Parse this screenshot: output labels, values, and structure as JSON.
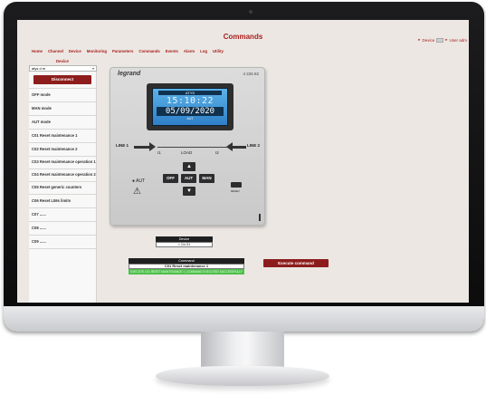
{
  "app": {
    "title": "Commands",
    "device_selector": "Device",
    "user_selector": "User adm"
  },
  "menu": {
    "items": [
      "Home",
      "Channel",
      "Device",
      "Monitoring",
      "Parameters",
      "Commands",
      "Events",
      "Alarm",
      "Log",
      "Utility"
    ],
    "sub_item": "Device"
  },
  "sidebar": {
    "select_value": "atys d m",
    "disconnect_label": "Disconnect",
    "items": [
      "OFF mode",
      "MAN mode",
      "AUT mode",
      "C01 Reset maintenance 1",
      "C02 Reset maintenance 2",
      "C03 Reset maintenance operation 1",
      "C04 Reset maintenance operation 2",
      "C05 Reset generic counters",
      "C06 Reset LIMs limits",
      "C07 ......",
      "C08 ......",
      "C09 ......"
    ]
  },
  "device_panel": {
    "brand": "legrand",
    "reference": "4 226 82",
    "lcd_header": "ATYS",
    "lcd_time": "15:10:22",
    "lcd_date": "05/09/2020",
    "lcd_footer": "AUT",
    "line1_label": "LINE 1",
    "line2_label": "LINE 2",
    "load_label": "LOAD",
    "i1_label": "I1",
    "i2_label": "I2",
    "aut_label": "AUT",
    "btn_off": "OFF",
    "btn_aut": "AUT",
    "btn_man": "MAN",
    "btn_up": "▲",
    "btn_down": "▼",
    "reset_label": "RESET"
  },
  "device_info": {
    "label": "Device",
    "value": "< 1/n 51"
  },
  "command": {
    "label": "Command",
    "value": "C01 Reset maintenance 1",
    "status": "EXECUTE C01 RESET MAINTENANCE 1 | COMMAND EXECUTED SUCCESSFULLY"
  },
  "execute_label": "Execute command",
  "colors": {
    "accent": "#a8211f",
    "button": "#8d1d1d",
    "success": "#4fbf4c",
    "screen_bg": "#ece7e3"
  }
}
